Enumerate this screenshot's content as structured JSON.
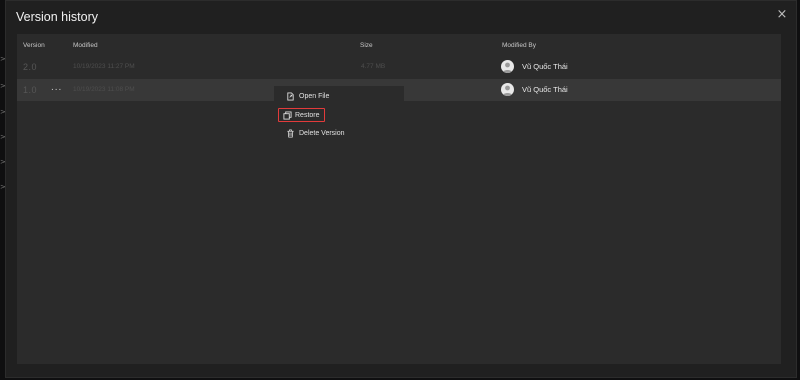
{
  "dialog": {
    "title": "Version history",
    "close_glyph": "×"
  },
  "columns": {
    "version": "Version",
    "modified": "Modified",
    "size": "Size",
    "modified_by": "Modified By"
  },
  "rows": [
    {
      "version": "2.0",
      "modified": "10/19/2023 11:27 PM",
      "size": "4.77 MB",
      "modified_by": "Vũ Quốc Thái",
      "selected": false
    },
    {
      "version": "1.0",
      "more": "...",
      "modified": "10/19/2023 11:08 PM",
      "size": "",
      "modified_by": "Vũ Quốc Thái",
      "selected": true
    }
  ],
  "context_menu": {
    "items": [
      {
        "label": "Open File",
        "icon": "open-file-icon"
      },
      {
        "label": "Restore",
        "icon": "restore-icon",
        "highlighted": true
      },
      {
        "label": "Delete Version",
        "icon": "trash-icon"
      }
    ],
    "highlight_color": "#e23b3b"
  },
  "edge_markers": [
    ">",
    ">",
    ">",
    ">",
    ">",
    ">"
  ]
}
